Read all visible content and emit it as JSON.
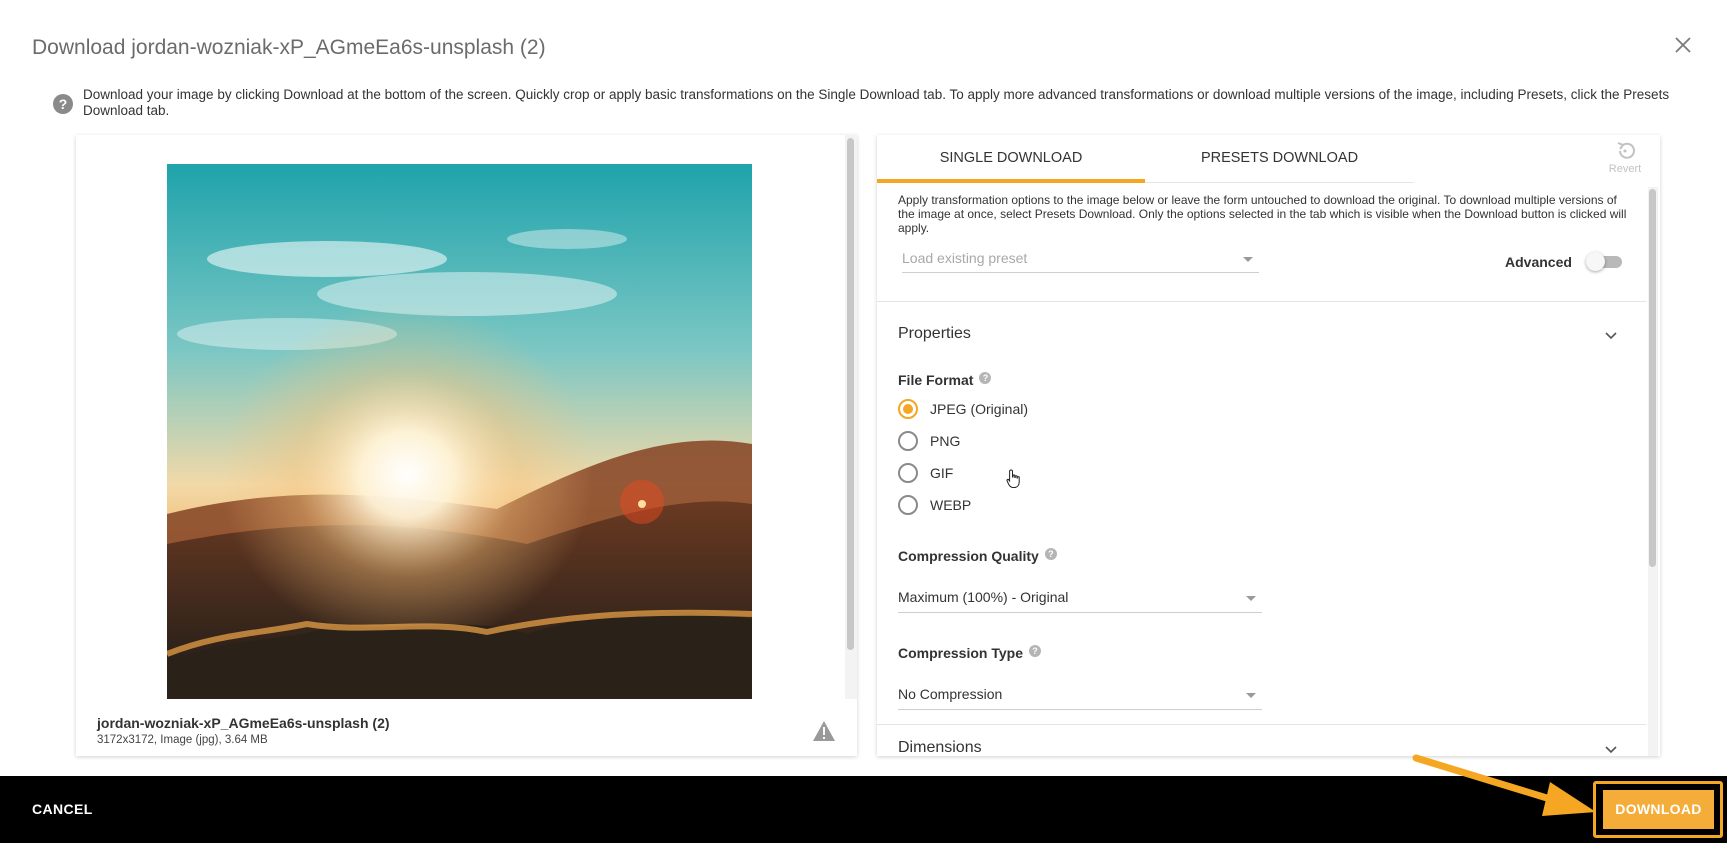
{
  "dialog": {
    "title": "Download jordan-wozniak-xP_AGmeEa6s-unsplash (2)",
    "info_text": "Download your image by clicking Download at the bottom of the screen. Quickly crop or apply basic transformations on the Single Download tab. To apply more advanced transformations or download multiple versions of the image, including Presets, click the Presets Download tab."
  },
  "preview": {
    "file_name": "jordan-wozniak-xP_AGmeEa6s-unsplash (2)",
    "file_meta": "3172x3172, Image (jpg), 3.64 MB",
    "warning_icon": "warning-triangle-icon"
  },
  "tabs": [
    {
      "label": "SINGLE DOWNLOAD",
      "active": true
    },
    {
      "label": "PRESETS DOWNLOAD",
      "active": false
    }
  ],
  "revert_label": "Revert",
  "options": {
    "description": "Apply transformation options to the image below or leave the form untouched to download the original. To download multiple versions of the image at once, select Presets Download. Only the options selected in the tab which is visible when the Download button is clicked will apply.",
    "preset_placeholder": "Load existing preset",
    "advanced_label": "Advanced",
    "advanced_enabled": false,
    "properties_title": "Properties",
    "file_format": {
      "label": "File Format",
      "options": [
        {
          "label": "JPEG (Original)",
          "selected": true
        },
        {
          "label": "PNG",
          "selected": false
        },
        {
          "label": "GIF",
          "selected": false
        },
        {
          "label": "WEBP",
          "selected": false
        }
      ]
    },
    "compression_quality": {
      "label": "Compression Quality",
      "value": "Maximum (100%) - Original"
    },
    "compression_type": {
      "label": "Compression Type",
      "value": "No Compression"
    },
    "dimensions_title": "Dimensions"
  },
  "footer": {
    "cancel_label": "CANCEL",
    "download_label": "DOWNLOAD"
  },
  "colors": {
    "accent": "#f5a623",
    "footer_bg": "#000000"
  }
}
